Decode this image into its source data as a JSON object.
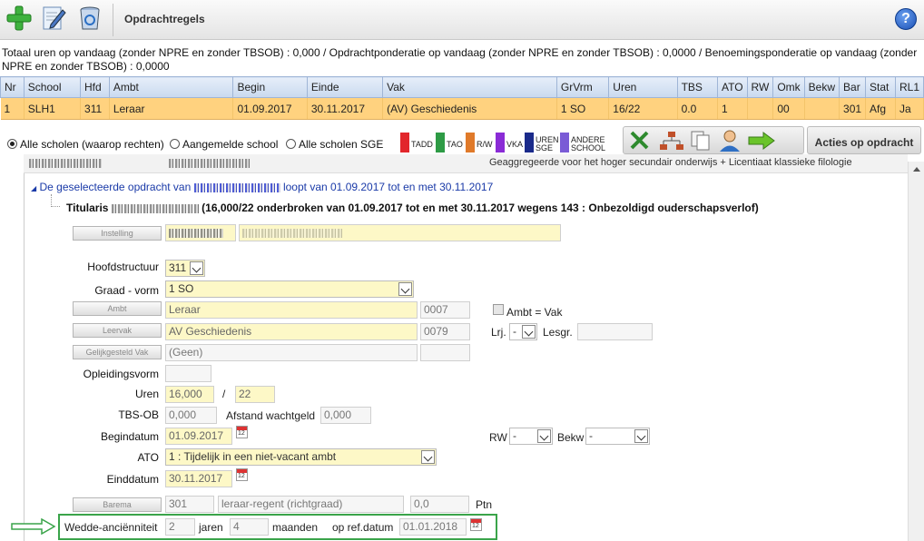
{
  "toolbar": {
    "title": "Opdrachtregels",
    "help_label": "?"
  },
  "summary": "Totaal uren op vandaag (zonder NPRE en zonder TBSOB) : 0,000 / Opdrachtponderatie op vandaag (zonder NPRE en zonder TBSOB) : 0,0000 / Benoemingsponderatie op vandaag (zonder NPRE en zonder TBSOB) : 0,0000",
  "table": {
    "headers": [
      "Nr",
      "School",
      "Hfd",
      "Ambt",
      "Begin",
      "Einde",
      "Vak",
      "GrVrm",
      "Uren",
      "TBS",
      "ATO",
      "RW",
      "Omk",
      "Bekw",
      "Bar",
      "Stat",
      "RL1"
    ],
    "rows": [
      [
        "1",
        "SLH1",
        "311",
        "Leraar",
        "01.09.2017",
        "30.11.2017",
        "(AV) Geschiedenis",
        "1 SO",
        "16/22",
        "0.0",
        "1",
        "",
        "00",
        "",
        "301",
        "Afg",
        "Ja"
      ]
    ]
  },
  "filters": {
    "alle_scholen_rechten": "Alle scholen (waarop rechten)",
    "aangemelde_school": "Aangemelde school",
    "alle_scholen_sge": "Alle scholen SGE"
  },
  "legend": [
    {
      "label": "TADD",
      "color": "#e2262b"
    },
    {
      "label": "TAO",
      "color": "#2e9b45"
    },
    {
      "label": "R/W",
      "color": "#e07a2a"
    },
    {
      "label": "VKA",
      "color": "#8a2bd6"
    },
    {
      "label": "UREN SGE",
      "color": "#1a2a8a"
    },
    {
      "label": "ANDERE SCHOOL",
      "color": "#7a5bd6"
    }
  ],
  "acties_label": "Acties op opdracht",
  "panel": {
    "header_right": "Geaggregeerde voor het hoger secundair onderwijs + Licentiaat klassieke filologie",
    "assignment_prefix": "De geselecteerde opdracht van",
    "assignment_suffix": "loopt van 01.09.2017 tot en met 30.11.2017",
    "titularis_prefix": "Titularis",
    "titularis_suffix": "(16,000/22 onderbroken van 01.09.2017 tot en met 30.11.2017 wegens 143 : Onbezoldigd ouderschapsverlof)"
  },
  "form": {
    "instelling_btn": "Instelling",
    "hoofdstructuur_label": "Hoofdstructuur",
    "hoofdstructuur_value": "311",
    "graad_label": "Graad - vorm",
    "graad_value": "1 SO",
    "ambt_btn": "Ambt",
    "ambt_value": "Leraar",
    "ambt_code": "0007",
    "ambt_vak_label": "Ambt = Vak",
    "leervak_btn": "Leervak",
    "leervak_value": "AV Geschiedenis",
    "leervak_code": "0079",
    "lrj_label": "Lrj.",
    "lrj_value": "-",
    "lesgr_label": "Lesgr.",
    "gelijk_btn": "Gelijkgesteld Vak",
    "gelijk_value": "(Geen)",
    "opleidingsvorm_label": "Opleidingsvorm",
    "uren_label": "Uren",
    "uren_value": "16,000",
    "uren_sep": "/",
    "uren_total": "22",
    "tbsob_label": "TBS-OB",
    "tbsob_value": "0,000",
    "afstand_label": "Afstand wachtgeld",
    "afstand_value": "0,000",
    "begindatum_label": "Begindatum",
    "begindatum_value": "01.09.2017",
    "rw_label": "RW",
    "rw_value": "-",
    "bekw_label": "Bekw",
    "bekw_value": "-",
    "ato_label": "ATO",
    "ato_value": "1 : Tijdelijk in een niet-vacant ambt",
    "einddatum_label": "Einddatum",
    "einddatum_value": "30.11.2017",
    "barema_btn": "Barema",
    "barema_code": "301",
    "barema_desc": "leraar-regent (richtgraad)",
    "barema_pt": "0,0",
    "ptn_label": "Ptn",
    "wedde_label": "Wedde-anciënniteit",
    "wedde_jaren": "2",
    "jaren_label": "jaren",
    "wedde_maanden": "4",
    "maanden_label": "maanden",
    "refdatum_label": "op ref.datum",
    "refdatum_value": "01.01.2018"
  }
}
